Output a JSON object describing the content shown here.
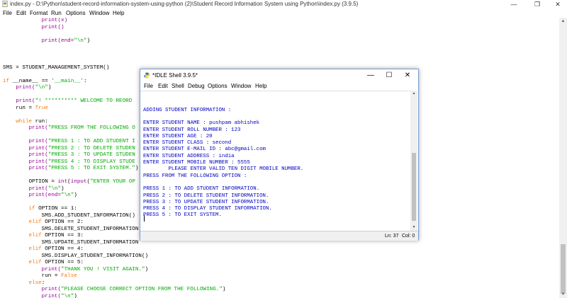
{
  "editor": {
    "title": "index.py - D:\\Python\\student-record-information-system-using-python (2)\\Student Record Information System using Python\\index.py (3.9.5)",
    "menu": [
      "File",
      "Edit",
      "Format",
      "Run",
      "Options",
      "Window",
      "Help"
    ],
    "window_buttons": {
      "minimize": "—",
      "restore": "❐",
      "close": "✕"
    },
    "code_lines": [
      [
        {
          "t": "            print(x)",
          "c": "bi"
        }
      ],
      [
        {
          "t": "            print()",
          "c": "bi"
        }
      ],
      [
        {
          "t": "",
          "c": ""
        }
      ],
      [
        {
          "t": "            print(end=",
          "c": "bi"
        },
        {
          "t": "\"\\n\"",
          "c": "st"
        },
        {
          "t": ")",
          "c": ""
        }
      ],
      [
        {
          "t": "",
          "c": ""
        }
      ],
      [
        {
          "t": "",
          "c": ""
        }
      ],
      [
        {
          "t": "",
          "c": ""
        }
      ],
      [
        {
          "t": "SMS = STUDENT_MANAGEMENT_SYSTEM()",
          "c": ""
        }
      ],
      [
        {
          "t": "",
          "c": ""
        }
      ],
      [
        {
          "t": "if",
          "c": "kw"
        },
        {
          "t": " __name__ == ",
          "c": ""
        },
        {
          "t": "'__main__'",
          "c": "st"
        },
        {
          "t": ":",
          "c": ""
        }
      ],
      [
        {
          "t": "    print(",
          "c": "bi"
        },
        {
          "t": "\"\\n\"",
          "c": "st"
        },
        {
          "t": ")",
          "c": ""
        }
      ],
      [
        {
          "t": "",
          "c": ""
        }
      ],
      [
        {
          "t": "    print(",
          "c": "bi"
        },
        {
          "t": "\"! ********** WELCOME TO REORD ",
          "c": "st"
        }
      ],
      [
        {
          "t": "    run = ",
          "c": ""
        },
        {
          "t": "True",
          "c": "kw"
        }
      ],
      [
        {
          "t": "",
          "c": ""
        }
      ],
      [
        {
          "t": "    while",
          "c": "kw"
        },
        {
          "t": " run:",
          "c": ""
        }
      ],
      [
        {
          "t": "        print(",
          "c": "bi"
        },
        {
          "t": "\"PRESS FROM THE FOLLOWING O",
          "c": "st"
        }
      ],
      [
        {
          "t": "",
          "c": ""
        }
      ],
      [
        {
          "t": "        print(",
          "c": "bi"
        },
        {
          "t": "\"PRESS 1 : TO ADD STUDENT I",
          "c": "st"
        }
      ],
      [
        {
          "t": "        print(",
          "c": "bi"
        },
        {
          "t": "\"PRESS 2 : TO DELETE STUDEN",
          "c": "st"
        }
      ],
      [
        {
          "t": "        print(",
          "c": "bi"
        },
        {
          "t": "\"PRESS 3 : TO UPDATE STUDEN",
          "c": "st"
        }
      ],
      [
        {
          "t": "        print(",
          "c": "bi"
        },
        {
          "t": "\"PRESS 4 : TO DISPLAY STUDE",
          "c": "st"
        }
      ],
      [
        {
          "t": "        print(",
          "c": "bi"
        },
        {
          "t": "\"PRESS 5 : TO EXIT SYSTEM.\"",
          "c": "st"
        },
        {
          "t": ")",
          "c": ""
        }
      ],
      [
        {
          "t": "",
          "c": ""
        }
      ],
      [
        {
          "t": "        OPTION = ",
          "c": ""
        },
        {
          "t": "int",
          "c": "bi"
        },
        {
          "t": "(",
          "c": ""
        },
        {
          "t": "input",
          "c": "bi"
        },
        {
          "t": "(",
          "c": ""
        },
        {
          "t": "\"ENTER YOUR OP",
          "c": "st"
        }
      ],
      [
        {
          "t": "        print(",
          "c": "bi"
        },
        {
          "t": "\"\\n\"",
          "c": "st"
        },
        {
          "t": ")",
          "c": ""
        }
      ],
      [
        {
          "t": "        print(end=",
          "c": "bi"
        },
        {
          "t": "\"\\n\"",
          "c": "st"
        },
        {
          "t": ")",
          "c": ""
        }
      ],
      [
        {
          "t": "",
          "c": ""
        }
      ],
      [
        {
          "t": "        if",
          "c": "kw"
        },
        {
          "t": " OPTION == 1:",
          "c": ""
        }
      ],
      [
        {
          "t": "            SMS.ADD_STUDENT_INFORMATION()",
          "c": ""
        }
      ],
      [
        {
          "t": "        elif",
          "c": "kw"
        },
        {
          "t": " OPTION == 2:",
          "c": ""
        }
      ],
      [
        {
          "t": "            SMS.DELETE_STUDENT_INFORMATION",
          "c": ""
        }
      ],
      [
        {
          "t": "        elif",
          "c": "kw"
        },
        {
          "t": " OPTION == 3:",
          "c": ""
        }
      ],
      [
        {
          "t": "            SMS.UPDATE_STUDENT_INFORMATION",
          "c": ""
        }
      ],
      [
        {
          "t": "        elif",
          "c": "kw"
        },
        {
          "t": " OPTION == 4:",
          "c": ""
        }
      ],
      [
        {
          "t": "            SMS.DISPLAY_STUDENT_INFORMATION()",
          "c": ""
        }
      ],
      [
        {
          "t": "        elif",
          "c": "kw"
        },
        {
          "t": " OPTION == 5:",
          "c": ""
        }
      ],
      [
        {
          "t": "            print(",
          "c": "bi"
        },
        {
          "t": "\"THANK YOU ! VISIT AGAIN.\"",
          "c": "st"
        },
        {
          "t": ")",
          "c": ""
        }
      ],
      [
        {
          "t": "            run = ",
          "c": ""
        },
        {
          "t": "False",
          "c": "kw"
        }
      ],
      [
        {
          "t": "        else",
          "c": "kw"
        },
        {
          "t": ":",
          "c": ""
        }
      ],
      [
        {
          "t": "            print(",
          "c": "bi"
        },
        {
          "t": "\"PLEASE CHOOSE CORRECT OPTION FROM THE FOLLOWING.\"",
          "c": "st"
        },
        {
          "t": ")",
          "c": ""
        }
      ],
      [
        {
          "t": "            print(",
          "c": "bi"
        },
        {
          "t": "\"\\n\"",
          "c": "st"
        },
        {
          "t": ")",
          "c": ""
        }
      ]
    ]
  },
  "shell": {
    "title": "*IDLE Shell 3.9.5*",
    "menu": [
      "File",
      "Edit",
      "Shell",
      "Debug",
      "Options",
      "Window",
      "Help"
    ],
    "window_buttons": {
      "minimize": "—",
      "maximize": "☐",
      "close": "✕"
    },
    "lines": [
      {
        "t": "",
        "c": "sh-out"
      },
      {
        "t": "",
        "c": "sh-out"
      },
      {
        "t": "ADDING STUDENT INFORMATION :",
        "c": "sh-out"
      },
      {
        "t": "",
        "c": "sh-out"
      },
      {
        "t": "ENTER STUDENT NAME : pushpam abhishek",
        "c": "sh-out"
      },
      {
        "t": "ENTER STUDENT ROLL NUMBER : 123",
        "c": "sh-out"
      },
      {
        "t": "ENTER STUDENT AGE : 20",
        "c": "sh-out"
      },
      {
        "t": "ENTER STUDENT CLASS : second",
        "c": "sh-out"
      },
      {
        "t": "ENTER STUDENT E-MAIL ID : abc@gmail.com",
        "c": "sh-out"
      },
      {
        "t": "ENTER STUDENT ADDRESS : india",
        "c": "sh-out"
      },
      {
        "t": "ENTER STUDENT MOBILE NUMBER : 5555",
        "c": "sh-out"
      },
      {
        "t": "        PLEASE ENTER VALID TEN DIGIT MOBILE NUMBER.",
        "c": "sh-out"
      },
      {
        "t": "PRESS FROM THE FOLLOWING OPTION :",
        "c": "sh-out"
      },
      {
        "t": "",
        "c": "sh-out"
      },
      {
        "t": "PRESS 1 : TO ADD STUDENT INFORMATION.",
        "c": "sh-out"
      },
      {
        "t": "PRESS 2 : TO DELETE STUDENT INFORMATION.",
        "c": "sh-out"
      },
      {
        "t": "PRESS 3 : TO UPDATE STUDENT INFORMATION.",
        "c": "sh-out"
      },
      {
        "t": "PRESS 4 : TO DISPLAY STUDENT INFORMATION.",
        "c": "sh-out"
      },
      {
        "t": "PRESS 5 : TO EXIT SYSTEM.",
        "c": "sh-out"
      }
    ],
    "status_ln": "Ln: 37",
    "status_col": "Col: 0"
  },
  "colors": {
    "keyword": "#ff7700",
    "builtin": "#900090",
    "string": "#00aa00",
    "shell_output": "#0000c0"
  }
}
